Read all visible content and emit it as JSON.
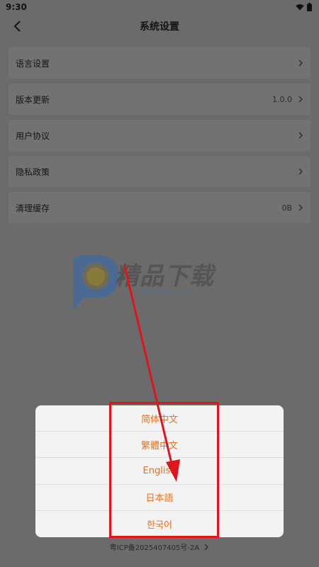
{
  "status_bar": {
    "time": "9:30"
  },
  "header": {
    "title": "系统设置"
  },
  "settings": [
    {
      "label": "语言设置",
      "value": ""
    },
    {
      "label": "版本更新",
      "value": "1.0.0"
    },
    {
      "label": "用户协议",
      "value": ""
    },
    {
      "label": "隐私政策",
      "value": ""
    },
    {
      "label": "清理缓存",
      "value": "0B"
    }
  ],
  "watermark": {
    "brand": "精品下载",
    "url": "www.j5p.com"
  },
  "footer": {
    "icp": "粤ICP备2025407405号-2A"
  },
  "language_sheet": {
    "options": [
      "简体中文",
      "繁體中文",
      "English",
      "日本語",
      "한국어"
    ],
    "option_color": "#e8721f"
  },
  "annotation_color": "#e0141a",
  "icons": [
    "wifi-icon",
    "battery-icon",
    "back-arrow-icon",
    "chevron-right-icon"
  ]
}
